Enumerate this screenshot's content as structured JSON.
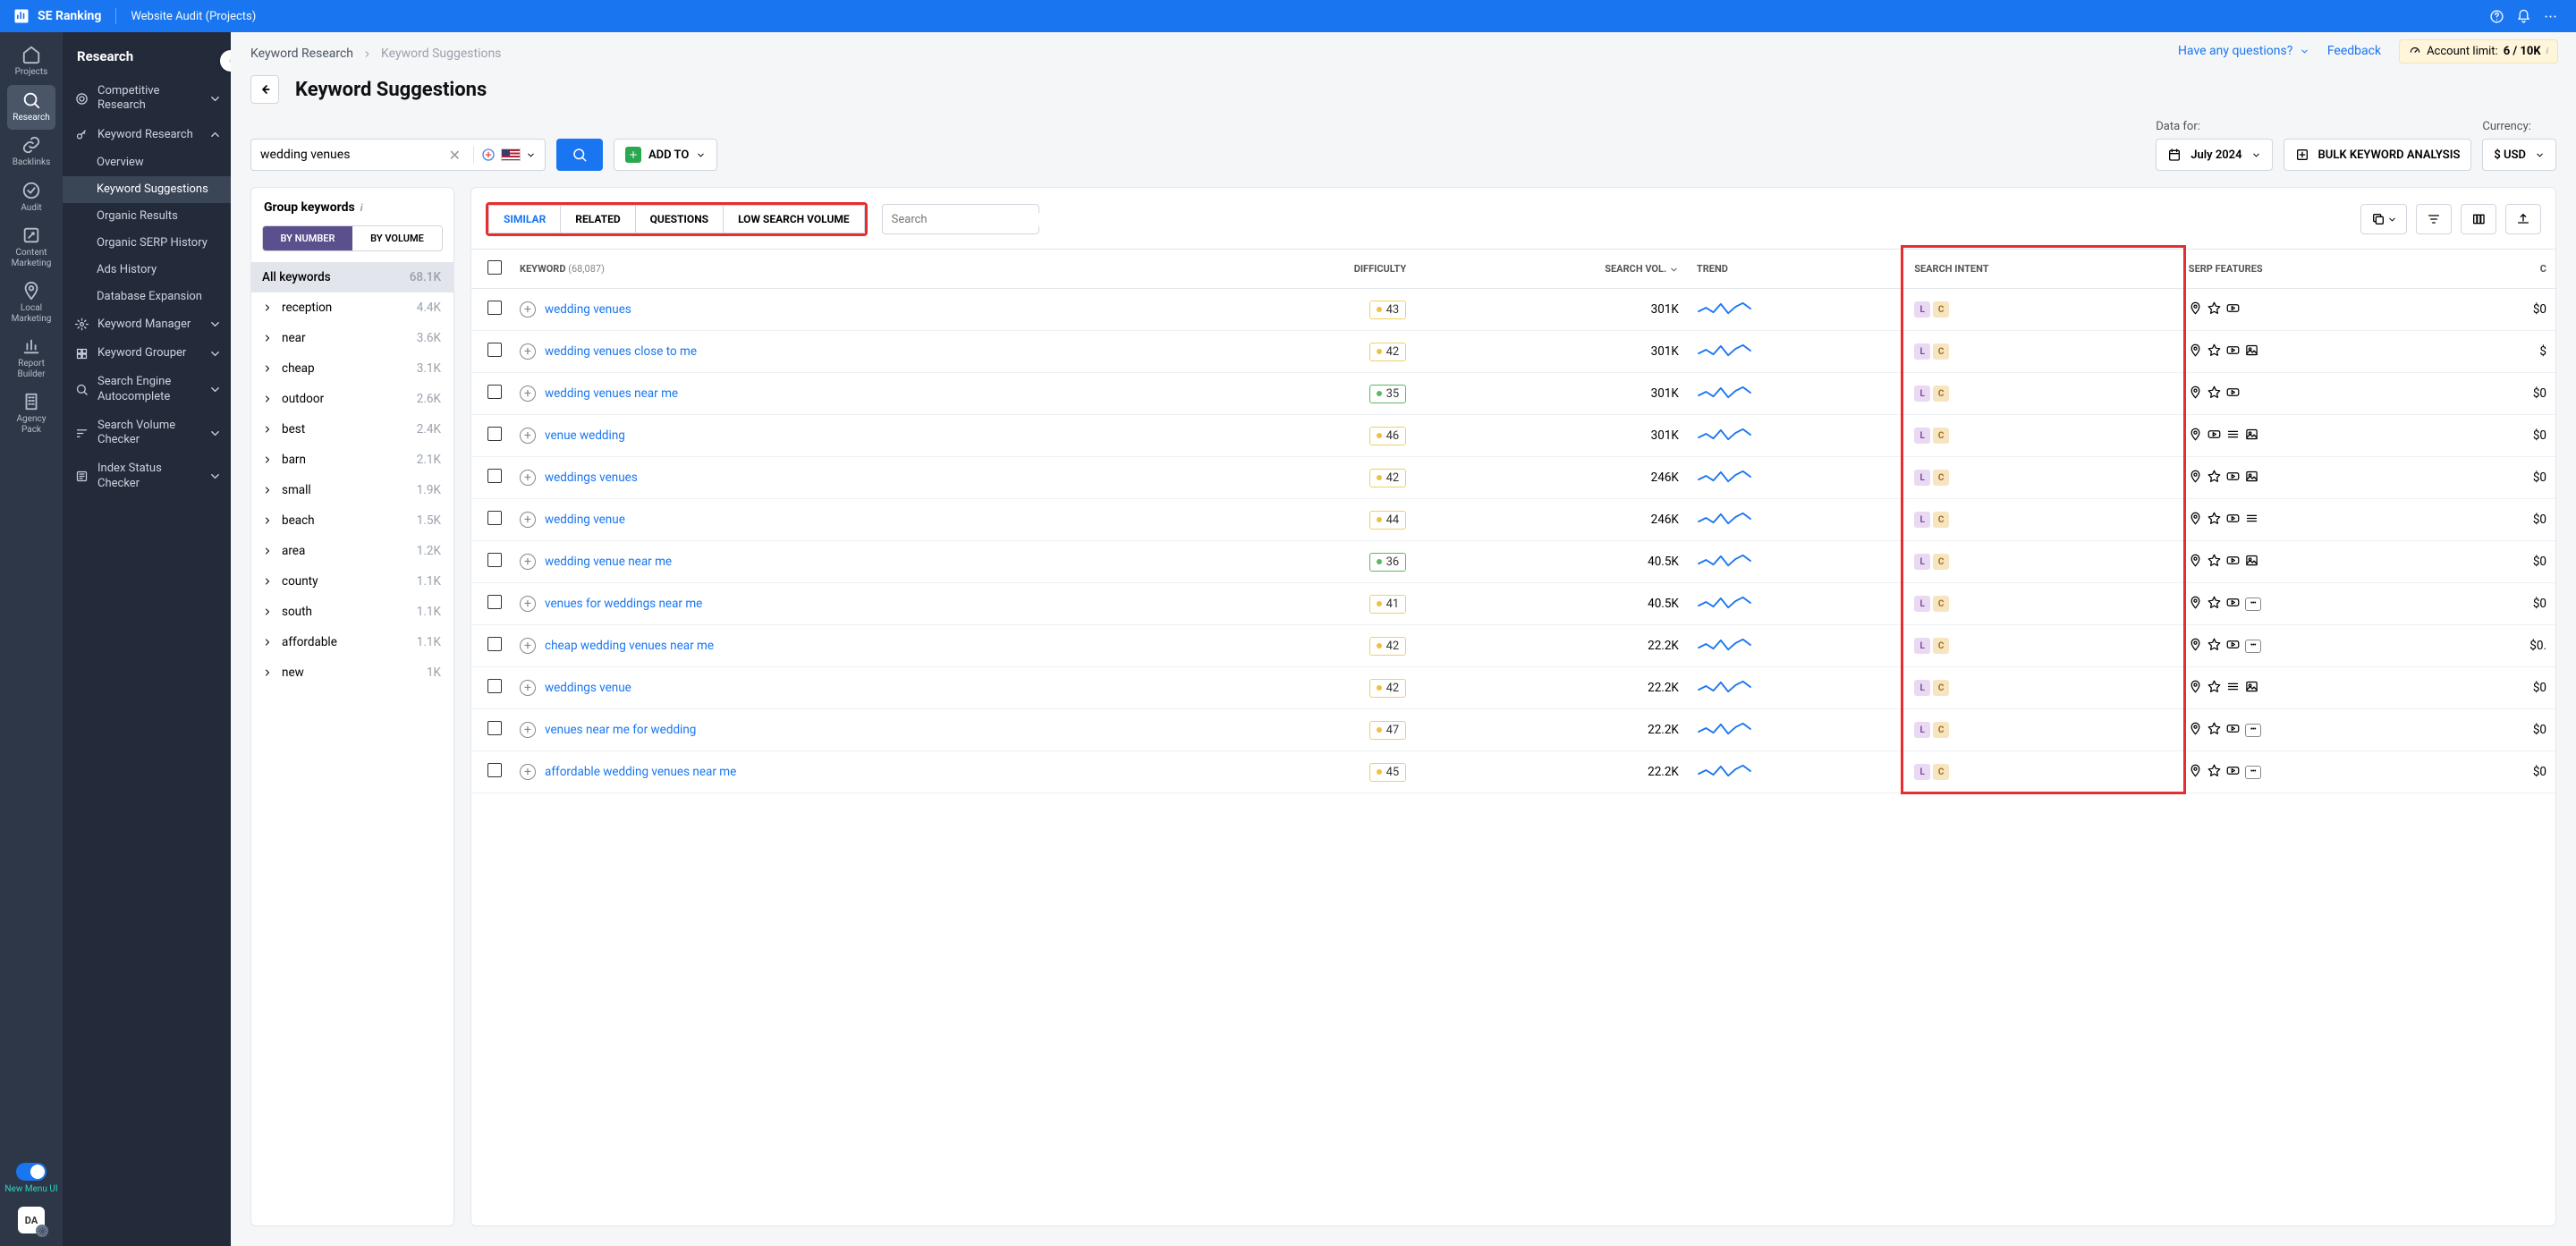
{
  "topbar": {
    "brand": "SE Ranking",
    "subtitle": "Website Audit (Projects)"
  },
  "rail": {
    "items": [
      {
        "icon": "home",
        "label": "Projects"
      },
      {
        "icon": "research",
        "label": "Research",
        "active": true
      },
      {
        "icon": "link",
        "label": "Backlinks"
      },
      {
        "icon": "check",
        "label": "Audit"
      },
      {
        "icon": "edit",
        "label": "Content Marketing"
      },
      {
        "icon": "pin",
        "label": "Local Marketing"
      },
      {
        "icon": "chart",
        "label": "Report Builder"
      },
      {
        "icon": "building",
        "label": "Agency Pack"
      }
    ],
    "toggle_label": "New Menu UI",
    "avatar": "DA"
  },
  "sidenav": {
    "header": "Research",
    "sections": [
      {
        "icon": "target",
        "label": "Competitive Research",
        "expandable": true
      },
      {
        "icon": "key",
        "label": "Keyword Research",
        "expandable": true,
        "expanded": true,
        "subs": [
          {
            "label": "Overview"
          },
          {
            "label": "Keyword Suggestions",
            "active": true
          },
          {
            "label": "Organic Results"
          },
          {
            "label": "Organic SERP History"
          },
          {
            "label": "Ads History"
          },
          {
            "label": "Database Expansion"
          }
        ]
      },
      {
        "icon": "gear",
        "label": "Keyword Manager",
        "expandable": true
      },
      {
        "icon": "grid",
        "label": "Keyword Grouper",
        "expandable": true
      },
      {
        "icon": "search",
        "label": "Search Engine Autocomplete",
        "expandable": true
      },
      {
        "icon": "bars",
        "label": "Search Volume Checker",
        "expandable": true
      },
      {
        "icon": "index",
        "label": "Index Status Checker",
        "expandable": true
      }
    ]
  },
  "breadcrumb": {
    "parent": "Keyword Research",
    "current": "Keyword Suggestions"
  },
  "bc_right": {
    "questions": "Have any questions?",
    "feedback": "Feedback",
    "limit_label": "Account limit:",
    "limit_value": "6 / 10K"
  },
  "page": {
    "title": "Keyword Suggestions"
  },
  "toolbar": {
    "search_value": "wedding venues",
    "addto": "ADD TO",
    "data_for_label": "Data for:",
    "data_for_value": "July 2024",
    "bulk": "BULK KEYWORD ANALYSIS",
    "currency_label": "Currency:",
    "currency_value": "$ USD"
  },
  "group_panel": {
    "header": "Group keywords",
    "tabs": [
      "BY NUMBER",
      "BY VOLUME"
    ],
    "all_label": "All keywords",
    "all_count": "68.1K",
    "groups": [
      {
        "label": "reception",
        "count": "4.4K"
      },
      {
        "label": "near",
        "count": "3.6K"
      },
      {
        "label": "cheap",
        "count": "3.1K"
      },
      {
        "label": "outdoor",
        "count": "2.6K"
      },
      {
        "label": "best",
        "count": "2.4K"
      },
      {
        "label": "barn",
        "count": "2.1K"
      },
      {
        "label": "small",
        "count": "1.9K"
      },
      {
        "label": "beach",
        "count": "1.5K"
      },
      {
        "label": "area",
        "count": "1.2K"
      },
      {
        "label": "county",
        "count": "1.1K"
      },
      {
        "label": "south",
        "count": "1.1K"
      },
      {
        "label": "affordable",
        "count": "1.1K"
      },
      {
        "label": "new",
        "count": "1K"
      }
    ]
  },
  "tp_tabs": [
    "SIMILAR",
    "RELATED",
    "QUESTIONS",
    "LOW SEARCH VOLUME"
  ],
  "tp_search_placeholder": "Search",
  "columns": {
    "keyword": "KEYWORD",
    "keyword_count": "(68,087)",
    "difficulty": "DIFFICULTY",
    "search_vol": "SEARCH VOL.",
    "trend": "TREND",
    "intent": "SEARCH INTENT",
    "serp": "SERP FEATURES",
    "cpc": "C"
  },
  "rows": [
    {
      "kw": "wedding venues",
      "diff": 43,
      "diff_c": "yellow",
      "vol": "301K",
      "intent": [
        "L",
        "C"
      ],
      "serp": [
        "pin",
        "star",
        "video"
      ],
      "cpc": "$0"
    },
    {
      "kw": "wedding venues close to me",
      "diff": 42,
      "diff_c": "yellow",
      "vol": "301K",
      "intent": [
        "L",
        "C"
      ],
      "serp": [
        "pin",
        "star",
        "video",
        "image"
      ],
      "cpc": "$"
    },
    {
      "kw": "wedding venues near me",
      "diff": 35,
      "diff_c": "green",
      "vol": "301K",
      "intent": [
        "L",
        "C"
      ],
      "serp": [
        "pin",
        "star",
        "video"
      ],
      "cpc": "$0"
    },
    {
      "kw": "venue wedding",
      "diff": 46,
      "diff_c": "yellow",
      "vol": "301K",
      "intent": [
        "L",
        "C"
      ],
      "serp": [
        "pin",
        "video",
        "list",
        "image"
      ],
      "cpc": "$0"
    },
    {
      "kw": "weddings venues",
      "diff": 42,
      "diff_c": "yellow",
      "vol": "246K",
      "intent": [
        "L",
        "C"
      ],
      "serp": [
        "pin",
        "star",
        "video",
        "image"
      ],
      "cpc": "$0"
    },
    {
      "kw": "wedding venue",
      "diff": 44,
      "diff_c": "yellow",
      "vol": "246K",
      "intent": [
        "L",
        "C"
      ],
      "serp": [
        "pin",
        "star",
        "video",
        "list"
      ],
      "cpc": "$0"
    },
    {
      "kw": "wedding venue near me",
      "diff": 36,
      "diff_c": "green",
      "vol": "40.5K",
      "intent": [
        "L",
        "C"
      ],
      "serp": [
        "pin",
        "star",
        "video",
        "image"
      ],
      "cpc": "$0"
    },
    {
      "kw": "venues for weddings near me",
      "diff": 41,
      "diff_c": "yellow",
      "vol": "40.5K",
      "intent": [
        "L",
        "C"
      ],
      "serp": [
        "pin",
        "star",
        "video",
        "more"
      ],
      "cpc": "$0"
    },
    {
      "kw": "cheap wedding venues near me",
      "diff": 42,
      "diff_c": "yellow",
      "vol": "22.2K",
      "intent": [
        "L",
        "C"
      ],
      "serp": [
        "pin",
        "star",
        "video",
        "more"
      ],
      "cpc": "$0."
    },
    {
      "kw": "weddings venue",
      "diff": 42,
      "diff_c": "yellow",
      "vol": "22.2K",
      "intent": [
        "L",
        "C"
      ],
      "serp": [
        "pin",
        "star",
        "list",
        "image"
      ],
      "cpc": "$0"
    },
    {
      "kw": "venues near me for wedding",
      "diff": 47,
      "diff_c": "yellow",
      "vol": "22.2K",
      "intent": [
        "L",
        "C"
      ],
      "serp": [
        "pin",
        "star",
        "video",
        "more"
      ],
      "cpc": "$0"
    },
    {
      "kw": "affordable wedding venues near me",
      "diff": 45,
      "diff_c": "yellow",
      "vol": "22.2K",
      "intent": [
        "L",
        "C"
      ],
      "serp": [
        "pin",
        "star",
        "video",
        "more"
      ],
      "cpc": "$0"
    }
  ]
}
